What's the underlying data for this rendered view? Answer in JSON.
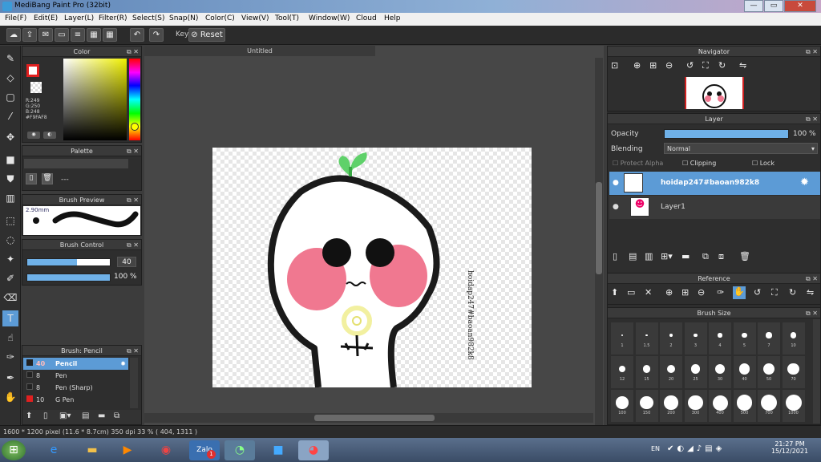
{
  "window": {
    "title": "MediBang Paint Pro (32bit)",
    "min": "—",
    "max": "▭",
    "close": "✕"
  },
  "menu": [
    "File(F)",
    "Edit(E)",
    "Layer(L)",
    "Filter(R)",
    "Select(S)",
    "Snap(N)",
    "Color(C)",
    "View(V)",
    "Tool(T)",
    "Window(W)",
    "Cloud",
    "Help"
  ],
  "toolbar": {
    "key_label": "Key",
    "reset_label": "Reset"
  },
  "color_panel": {
    "title": "Color",
    "r": "R:249",
    "g": "G:250",
    "b": "B:248",
    "hex": "#F9FAF8",
    "accent": "#e02020"
  },
  "palette_panel": {
    "title": "Palette",
    "placeholder": "---"
  },
  "brush_preview": {
    "title": "Brush Preview",
    "size": "2.90mm"
  },
  "brush_control": {
    "title": "Brush Control",
    "size_value": "40",
    "opacity_value": "100 %",
    "size_fraction": 0.6,
    "opacity_fraction": 1.0
  },
  "brush_list": {
    "title": "Brush: Pencil",
    "items": [
      {
        "size": "40",
        "name": "Pencil",
        "color": "#222"
      },
      {
        "size": "8",
        "name": "Pen",
        "color": "#222"
      },
      {
        "size": "8",
        "name": "Pen (Sharp)",
        "color": "#222"
      },
      {
        "size": "10",
        "name": "G Pen",
        "color": "#e02020"
      }
    ]
  },
  "canvas_tab": {
    "title": "Untitled"
  },
  "artwork": {
    "text": "hoidap247#baoan982k8"
  },
  "navigator": {
    "title": "Navigator"
  },
  "layer_panel": {
    "title": "Layer",
    "opacity_label": "Opacity",
    "opacity_value": "100 %",
    "opacity_fraction": 1.0,
    "blending_label": "Blending",
    "blending_value": "Normal",
    "protect_alpha": "Protect Alpha",
    "clipping": "Clipping",
    "lock": "Lock",
    "layers": [
      {
        "name": "hoidap247#baoan982k8",
        "selected": true
      },
      {
        "name": "Layer1",
        "selected": false
      }
    ]
  },
  "reference": {
    "title": "Reference"
  },
  "brush_size": {
    "title": "Brush Size",
    "sizes": [
      "1",
      "1.5",
      "2",
      "3",
      "4",
      "5",
      "7",
      "10",
      "12",
      "15",
      "20",
      "25",
      "30",
      "40",
      "50",
      "70",
      "100",
      "150",
      "200",
      "300",
      "400",
      "500",
      "700",
      "1000"
    ]
  },
  "status": {
    "text": "1600 * 1200 pixel  (11.6 * 8.7cm)  350 dpi  33 %  ( 404, 1311 )"
  },
  "taskbar": {
    "lang": "EN",
    "time": "21:27 PM",
    "date": "15/12/2021",
    "zalo_badge": "1"
  }
}
